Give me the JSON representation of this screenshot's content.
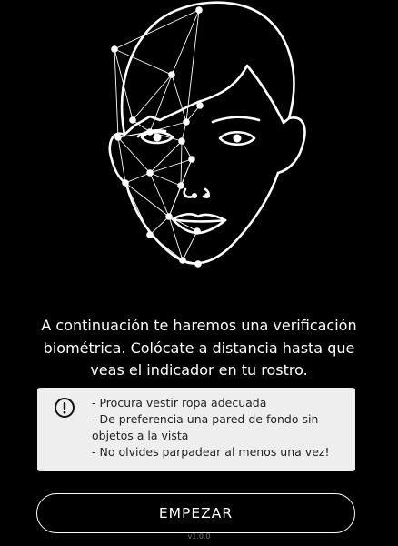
{
  "colors": {
    "background": "#000000",
    "foreground": "#ffffff",
    "panel_background": "#eeeeee",
    "panel_text": "#222222",
    "version_text": "#777777"
  },
  "illustration": {
    "icon": "face-mesh-icon"
  },
  "instructions": {
    "text": "A continuación te haremos una verificación biométrica. Colócate a distancia hasta que veas el indicador en tu rostro."
  },
  "tips": {
    "icon": "alert-circle-icon",
    "items": [
      "- Procura vestir ropa adecuada",
      "- De preferencia una pared de fondo sin objetos a la vista",
      "- No olvides parpadear al menos una vez!"
    ]
  },
  "actions": {
    "start_label": "EMPEZAR"
  },
  "footer": {
    "version": "v1.0.0"
  }
}
